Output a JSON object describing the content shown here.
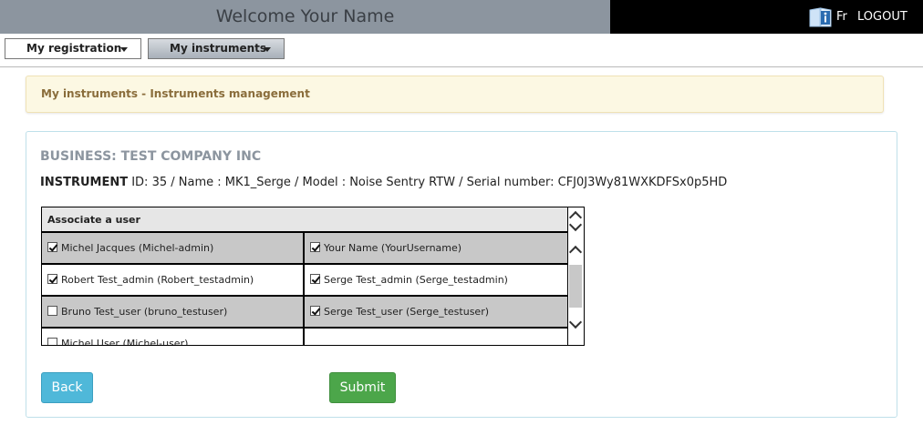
{
  "header": {
    "welcome_text": "Welcome  Your Name",
    "lang_label": "Fr",
    "logout_label": "LOGOUT",
    "info_icon": "book-info-icon"
  },
  "menu": {
    "registration_label": "My registration",
    "instruments_label": "My instruments"
  },
  "breadcrumb": "My instruments - Instruments management",
  "panel": {
    "business": "BUSINESS: TEST COMPANY INC",
    "instrument_label": "INSTRUMENT",
    "instrument_details": " ID: 35 / Name : MK1_Serge / Model : Noise Sentry RTW / Serial number: CFJ0J3Wy81WXKDFSx0p5HD"
  },
  "table": {
    "header": "Associate a user",
    "rows": [
      {
        "left": {
          "label": "Michel Jacques (Michel-admin)",
          "checked": true
        },
        "right": {
          "label": "Your Name (YourUsername)",
          "checked": true
        },
        "shaded": true
      },
      {
        "left": {
          "label": "Robert Test_admin (Robert_testadmin)",
          "checked": true
        },
        "right": {
          "label": "Serge Test_admin (Serge_testadmin)",
          "checked": true
        },
        "shaded": false
      },
      {
        "left": {
          "label": "Bruno Test_user (bruno_testuser)",
          "checked": false
        },
        "right": {
          "label": "Serge Test_user (Serge_testuser)",
          "checked": true
        },
        "shaded": true
      },
      {
        "left": {
          "label": "Michel User (Michel-user)",
          "checked": false
        },
        "right": {
          "label": "",
          "checked": false
        },
        "shaded": false
      }
    ]
  },
  "buttons": {
    "back_label": "Back",
    "submit_label": "Submit"
  },
  "colors": {
    "welcome_bg": "#8c959f",
    "back_btn": "#4fb8d9",
    "submit_btn": "#4ca64a",
    "alert_bg": "#fcf8e3"
  }
}
